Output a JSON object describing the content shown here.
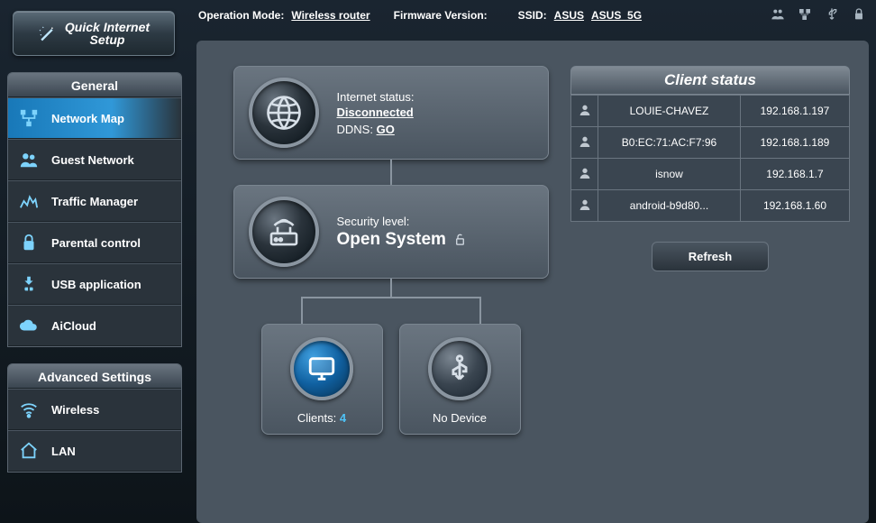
{
  "topbar": {
    "op_mode_label": "Operation Mode:",
    "op_mode_value": "Wireless router",
    "fw_label": "Firmware Version:",
    "fw_value": "",
    "ssid_label": "SSID:",
    "ssid_1": "ASUS",
    "ssid_2": "ASUS_5G"
  },
  "quick_setup": {
    "line1": "Quick Internet",
    "line2": "Setup"
  },
  "sidebar": {
    "general_header": "General",
    "advanced_header": "Advanced Settings",
    "items": [
      {
        "label": "Network Map"
      },
      {
        "label": "Guest Network"
      },
      {
        "label": "Traffic Manager"
      },
      {
        "label": "Parental control"
      },
      {
        "label": "USB application"
      },
      {
        "label": "AiCloud"
      }
    ],
    "advanced": [
      {
        "label": "Wireless"
      },
      {
        "label": "LAN"
      }
    ]
  },
  "map": {
    "internet": {
      "label": "Internet status:",
      "status": "Disconnected",
      "ddns_label": "DDNS:",
      "ddns_action": "GO"
    },
    "security": {
      "label": "Security level:",
      "value": "Open System"
    },
    "clients": {
      "label": "Clients:",
      "count": "4"
    },
    "usb": {
      "label": "No Device"
    }
  },
  "client_panel": {
    "header": "Client status",
    "refresh": "Refresh",
    "rows": [
      {
        "name": "LOUIE-CHAVEZ",
        "ip": "192.168.1.197"
      },
      {
        "name": "B0:EC:71:AC:F7:96",
        "ip": "192.168.1.189"
      },
      {
        "name": "isnow",
        "ip": "192.168.1.7"
      },
      {
        "name": "android-b9d80...",
        "ip": "192.168.1.60"
      }
    ]
  }
}
